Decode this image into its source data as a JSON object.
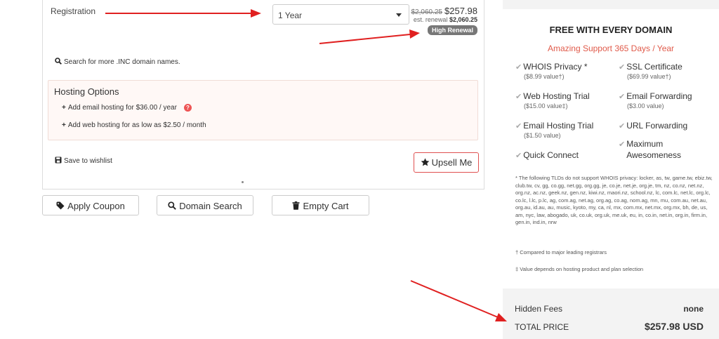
{
  "cart": {
    "registration_label": "Registration",
    "period_value": "1 Year",
    "price_old": "$2,060.25",
    "price_new": "$257.98",
    "renewal_prefix": "est. renewal",
    "renewal_price": "$2,060.25",
    "renewal_badge": "High Renewal",
    "search_more": "Search for more .INC domain names.",
    "hosting_title": "Hosting Options",
    "hosting_email": "Add email hosting for $36.00 / year",
    "hosting_web": "Add web hosting for as low as $2.50 / month",
    "wishlist": "Save to wishlist",
    "upsell": "Upsell Me"
  },
  "actions": {
    "apply_coupon": "Apply Coupon",
    "domain_search": "Domain Search",
    "empty_cart": "Empty Cart"
  },
  "sidebar": {
    "title": "FREE WITH EVERY DOMAIN",
    "subtitle": "Amazing Support 365 Days / Year",
    "features": [
      {
        "name": "WHOIS Privacy *",
        "value": "($8.99 value†)"
      },
      {
        "name": "SSL Certificate",
        "value": "($69.99 value†)"
      },
      {
        "name": "Web Hosting Trial",
        "value": "($15.00 value‡)"
      },
      {
        "name": "Email Forwarding",
        "value": "($3.00 value)"
      },
      {
        "name": "Email Hosting Trial",
        "value": "($1.50 value)"
      },
      {
        "name": "URL Forwarding",
        "value": ""
      },
      {
        "name": "Quick Connect",
        "value": ""
      },
      {
        "name": "Maximum Awesomeness",
        "value": ""
      }
    ],
    "note_whois": "* The following TLDs do not support WHOIS privacy: locker, as, tw, game.tw, ebiz.tw, club.tw, cv, gg, co.gg, net.gg, org.gg, je, co.je, net.je, org.je, tm, nz, co.nz, net.nz, org.nz, ac.nz, geek.nz, gen.nz, kiwi.nz, maori.nz, school.nz, lc, com.lc, net.lc, org.lc, co.lc, l.lc, p.lc, ag, com.ag, net.ag, org.ag, co.ag, nom.ag, mn, mu, com.au, net.au, org.au, id.au, au, music, kyoto, my, ca, nl, mx, com.mx, net.mx, org.mx, bh, de, us, am, nyc, law, abogado, uk, co.uk, org.uk, me.uk, eu, in, co.in, net.in, org.in, firm.in, gen.in, ind.in, nrw",
    "note_compared": "† Compared to major leading registrars",
    "note_value": "‡ Value depends on hosting product and plan selection",
    "hidden_fees_label": "Hidden Fees",
    "hidden_fees_value": "none",
    "total_label": "TOTAL PRICE",
    "total_value": "$257.98 USD"
  },
  "colors": {
    "accent_red": "#e05a4a",
    "arrow_red": "#e02020",
    "badge_grey": "#777777"
  },
  "icons": [
    "search-icon",
    "help-icon",
    "save-icon",
    "star-icon",
    "tag-icon",
    "trash-icon",
    "check-icon"
  ]
}
